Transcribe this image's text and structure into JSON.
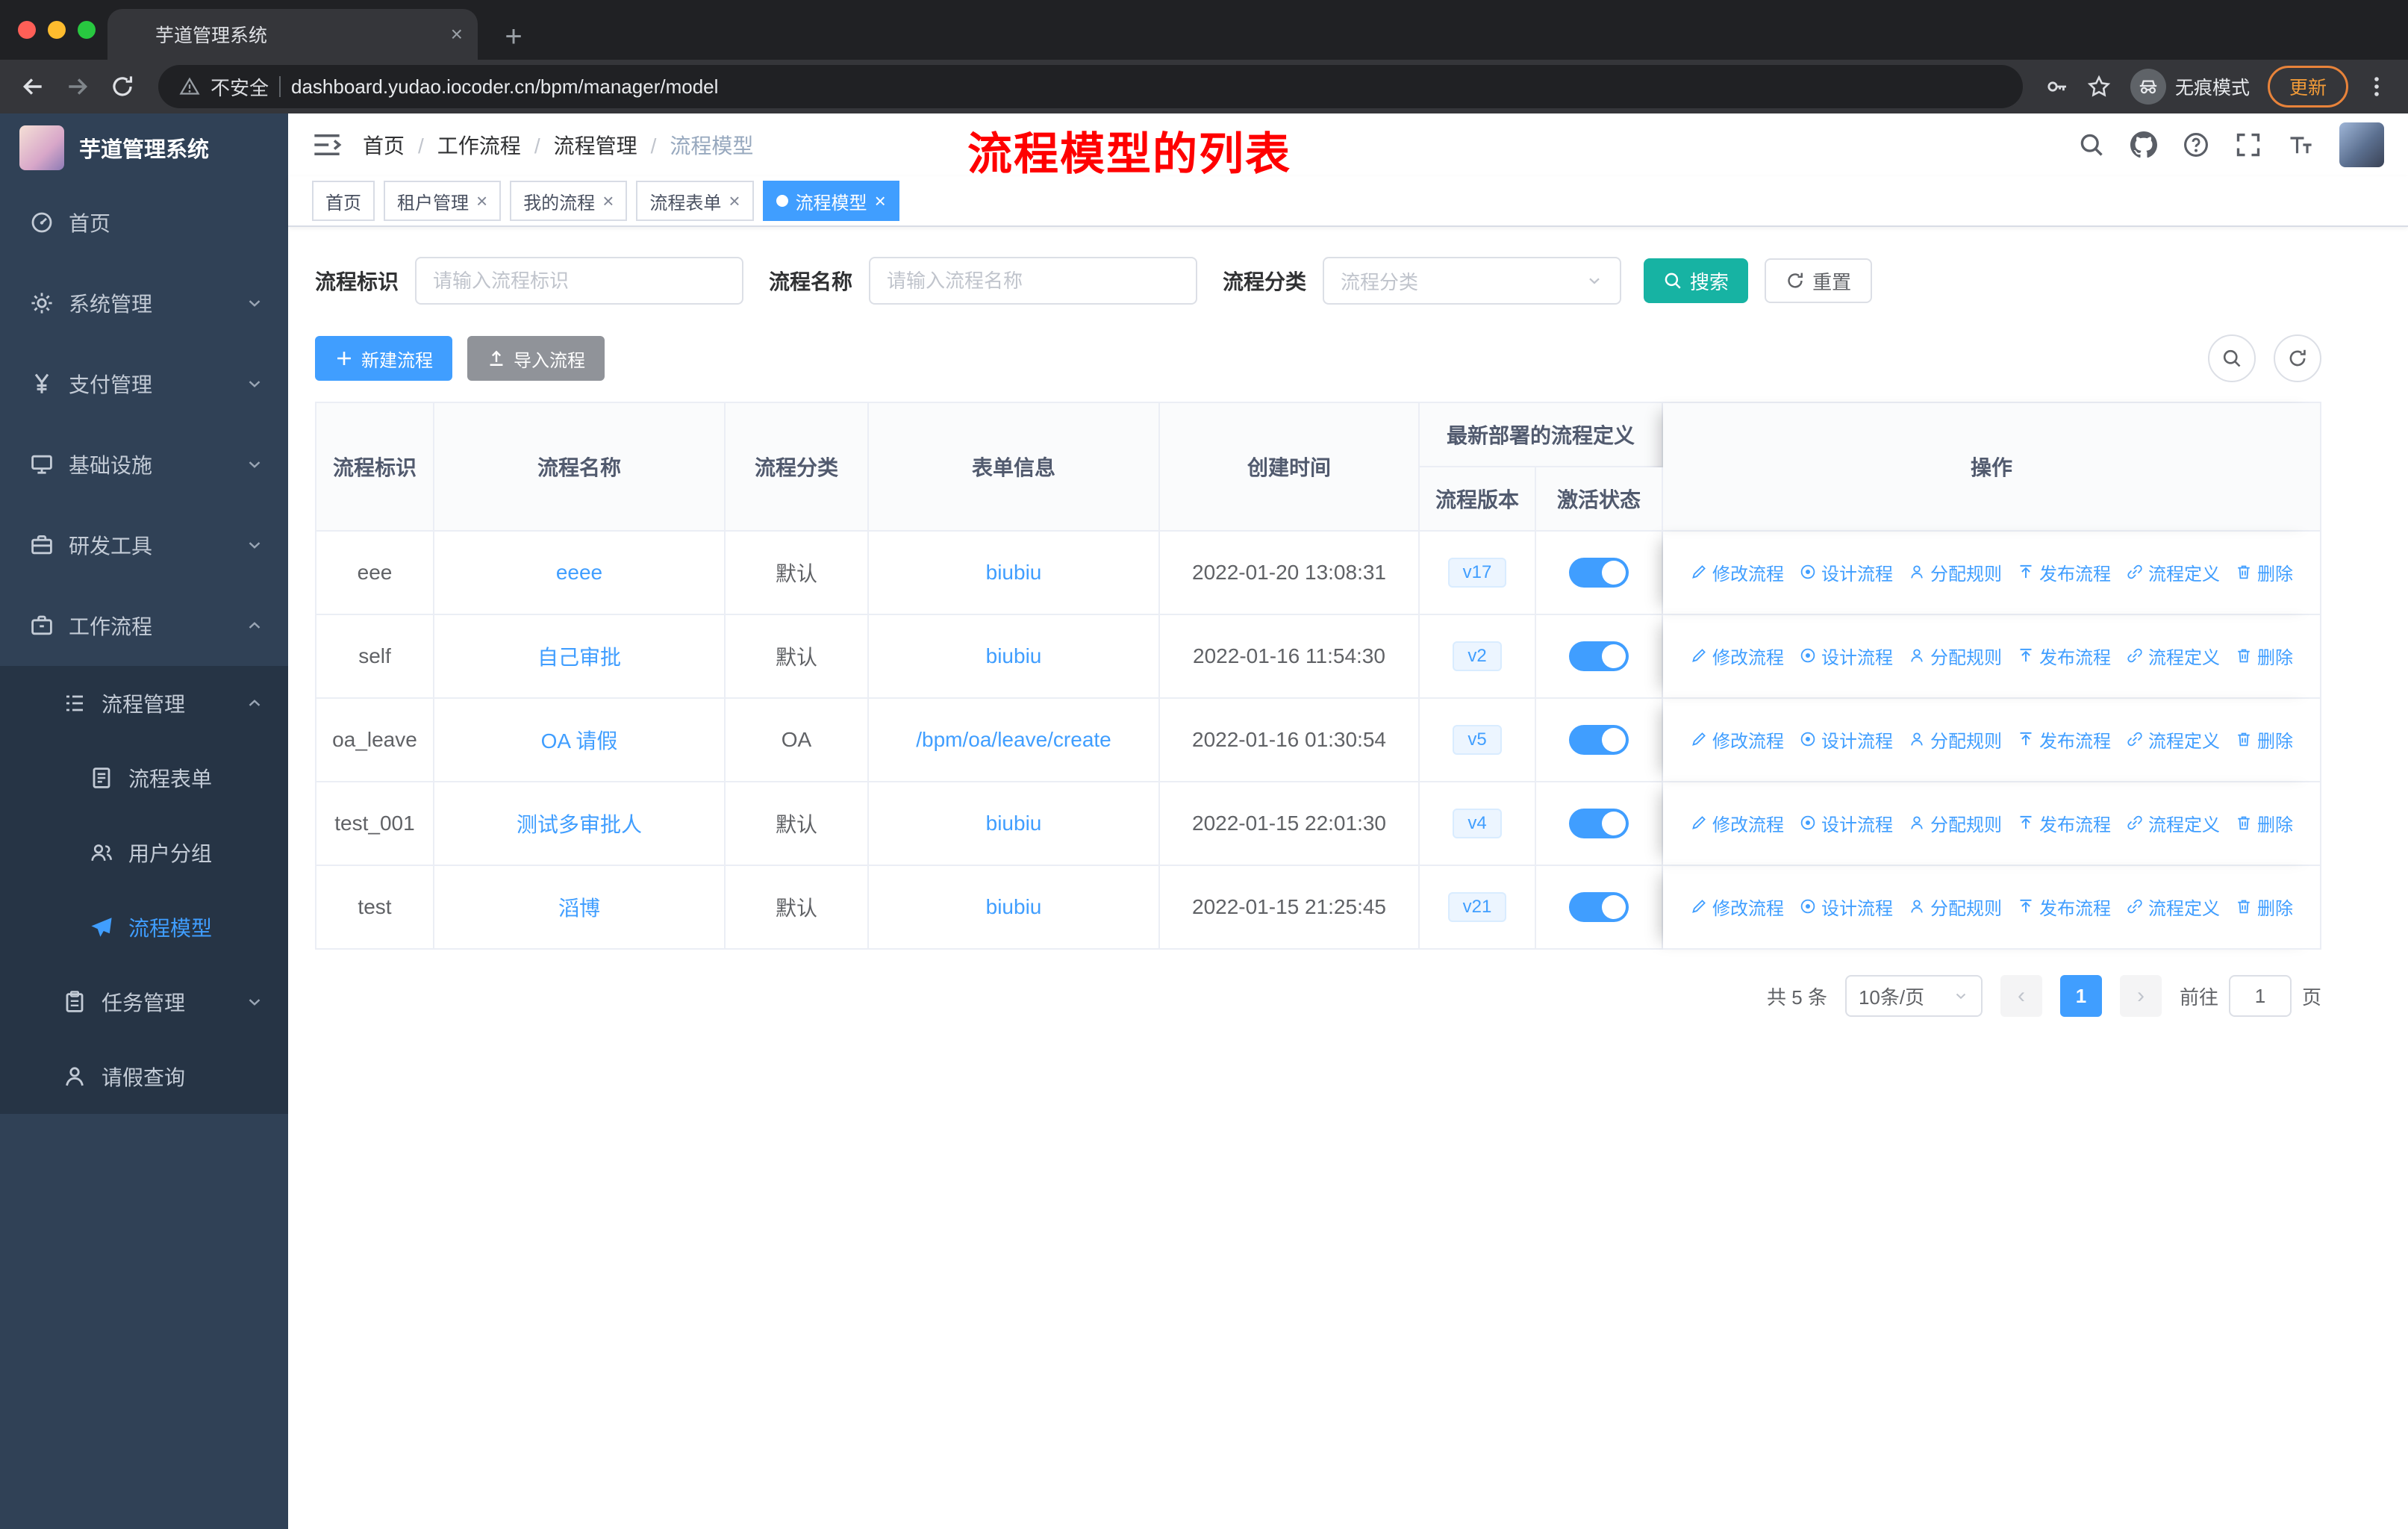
{
  "colors": {
    "accent": "#409eff",
    "search_button": "#17b3a3",
    "annotation": "#ff0000",
    "sidebar_bg": "#304156",
    "active_tag": "#409eff"
  },
  "browser": {
    "tab": {
      "title": "芋道管理系统",
      "favicon": "leaf-icon"
    },
    "address": {
      "security_label": "不安全",
      "url": "dashboard.yudao.iocoder.cn/bpm/manager/model"
    },
    "incognito_label": "无痕模式",
    "update_label": "更新"
  },
  "sidebar": {
    "logo_title": "芋道管理系统",
    "items": [
      {
        "label": "首页",
        "icon": "dashboard-icon",
        "depth": 1
      },
      {
        "label": "系统管理",
        "icon": "gear-icon",
        "depth": 1,
        "chevron": "down"
      },
      {
        "label": "支付管理",
        "icon": "yen-icon",
        "depth": 1,
        "chevron": "down"
      },
      {
        "label": "基础设施",
        "icon": "monitor-icon",
        "depth": 1,
        "chevron": "down"
      },
      {
        "label": "研发工具",
        "icon": "toolbox-icon",
        "depth": 1,
        "chevron": "down"
      },
      {
        "label": "工作流程",
        "icon": "briefcase-icon",
        "depth": 1,
        "chevron": "up"
      },
      {
        "label": "流程管理",
        "icon": "list-icon",
        "depth": 2,
        "chevron": "up",
        "sub": true
      },
      {
        "label": "流程表单",
        "icon": "form-icon",
        "depth": 3,
        "sub": true
      },
      {
        "label": "用户分组",
        "icon": "users-icon",
        "depth": 3,
        "sub": true
      },
      {
        "label": "流程模型",
        "icon": "plane-icon",
        "depth": 3,
        "sub": true,
        "active": true
      },
      {
        "label": "任务管理",
        "icon": "clipboard-icon",
        "depth": 2,
        "chevron": "down",
        "sub": true
      },
      {
        "label": "请假查询",
        "icon": "person-icon",
        "depth": 2,
        "sub": true
      }
    ]
  },
  "header": {
    "breadcrumb": [
      "首页",
      "工作流程",
      "流程管理",
      "流程模型"
    ],
    "annotation": "流程模型的列表"
  },
  "tabs": [
    {
      "label": "首页",
      "closable": false,
      "active": false
    },
    {
      "label": "租户管理",
      "closable": true,
      "active": false
    },
    {
      "label": "我的流程",
      "closable": true,
      "active": false
    },
    {
      "label": "流程表单",
      "closable": true,
      "active": false
    },
    {
      "label": "流程模型",
      "closable": true,
      "active": true
    }
  ],
  "filters": {
    "fields": [
      {
        "label": "流程标识",
        "placeholder": "请输入流程标识",
        "type": "input"
      },
      {
        "label": "流程名称",
        "placeholder": "请输入流程名称",
        "type": "input"
      },
      {
        "label": "流程分类",
        "placeholder": "流程分类",
        "type": "select"
      }
    ],
    "search_label": "搜索",
    "reset_label": "重置"
  },
  "toolbar": {
    "create_label": "新建流程",
    "import_label": "导入流程"
  },
  "table": {
    "headers": {
      "id": "流程标识",
      "name": "流程名称",
      "category": "流程分类",
      "form": "表单信息",
      "created": "创建时间",
      "deploy_group": "最新部署的流程定义",
      "version": "流程版本",
      "status": "激活状态",
      "ops": "操作"
    },
    "actions": [
      "修改流程",
      "设计流程",
      "分配规则",
      "发布流程",
      "流程定义",
      "删除"
    ],
    "action_icons": [
      "edit-icon",
      "design-icon",
      "assign-icon",
      "publish-icon",
      "definition-icon",
      "delete-icon"
    ],
    "action_names": [
      "modify-process",
      "design-process",
      "assign-rule",
      "deploy-process",
      "process-definition",
      "delete-process"
    ],
    "rows": [
      {
        "id": "eee",
        "name": "eeee",
        "category": "默认",
        "form": "biubiu",
        "created": "2022-01-20 13:08:31",
        "version": "v17",
        "active": true
      },
      {
        "id": "self",
        "name": "自己审批",
        "category": "默认",
        "form": "biubiu",
        "created": "2022-01-16 11:54:30",
        "version": "v2",
        "active": true
      },
      {
        "id": "oa_leave",
        "name": "OA 请假",
        "category": "OA",
        "form": "/bpm/oa/leave/create",
        "created": "2022-01-16 01:30:54",
        "version": "v5",
        "active": true
      },
      {
        "id": "test_001",
        "name": "测试多审批人",
        "category": "默认",
        "form": "biubiu",
        "created": "2022-01-15 22:01:30",
        "version": "v4",
        "active": true
      },
      {
        "id": "test",
        "name": "滔博",
        "category": "默认",
        "form": "biubiu",
        "created": "2022-01-15 21:25:45",
        "version": "v21",
        "active": true
      }
    ]
  },
  "pagination": {
    "total": "共 5 条",
    "page_size": "10条/页",
    "current": "1",
    "goto_prefix": "前往",
    "goto_value": "1",
    "goto_suffix": "页"
  }
}
